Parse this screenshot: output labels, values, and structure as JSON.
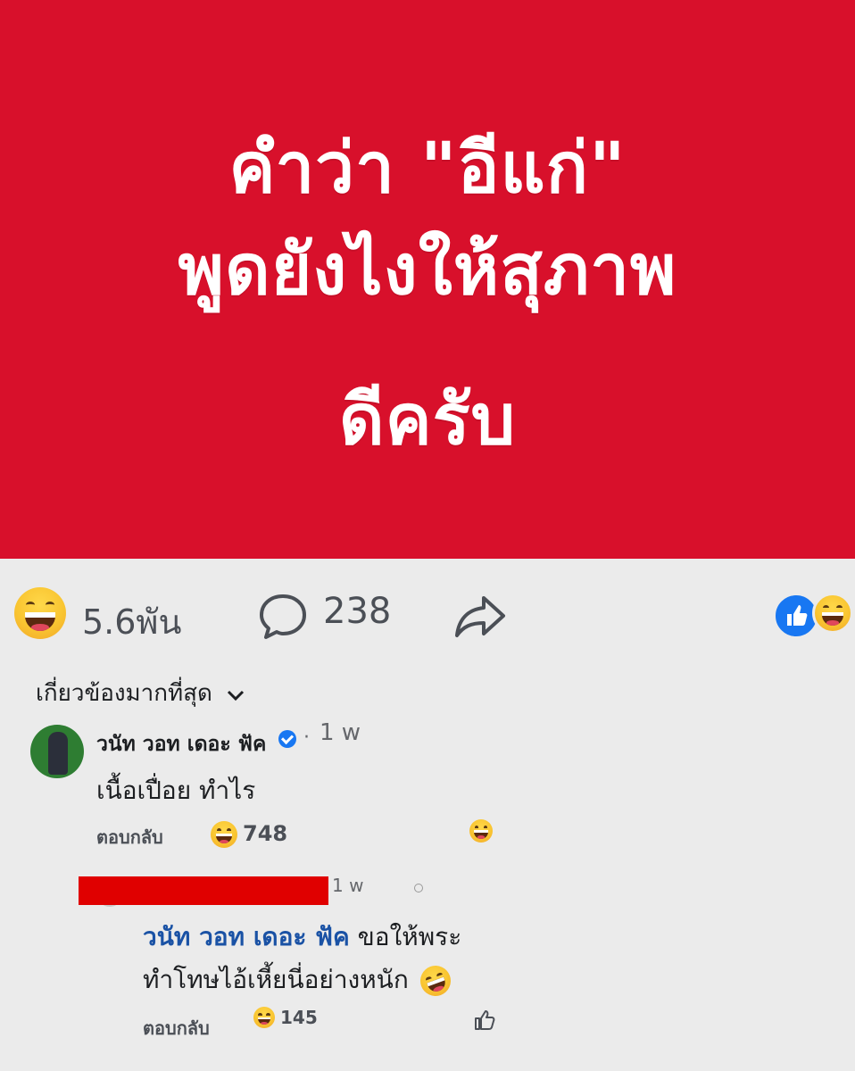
{
  "post": {
    "image_lines": [
      "คำว่า \"อีแก่\"",
      "พูดยังไงให้สุภาพ",
      "ดีครับ"
    ],
    "image_bg": "#d8102b"
  },
  "actions": {
    "reaction_count": "5.6พัน",
    "comment_count": "238"
  },
  "sort": {
    "label": "เกี่ยวข้องมากที่สุด"
  },
  "comments": [
    {
      "name": "วนัท วอท เดอะ ฟัค",
      "time": "1 w",
      "text": "เนื้อเปื่อย ทำไร",
      "reply_label": "ตอบกลับ",
      "reaction_count": "748"
    },
    {
      "time": "1 w",
      "mention": "วนัท วอท เดอะ ฟัค",
      "text": " ขอให้พระทำโทษไอ้เหี้ยนี่อย่างหนัก",
      "reply_label": "ตอบกลับ",
      "reaction_count": "145"
    }
  ],
  "icons": {
    "reaction": "laugh-emoji-icon",
    "comment": "comment-bubble-icon",
    "share": "share-arrow-icon",
    "like": "like-thumb-icon",
    "verified": "verified-badge-icon"
  },
  "colors": {
    "accent": "#1877f2",
    "mention": "#1a52a5"
  }
}
